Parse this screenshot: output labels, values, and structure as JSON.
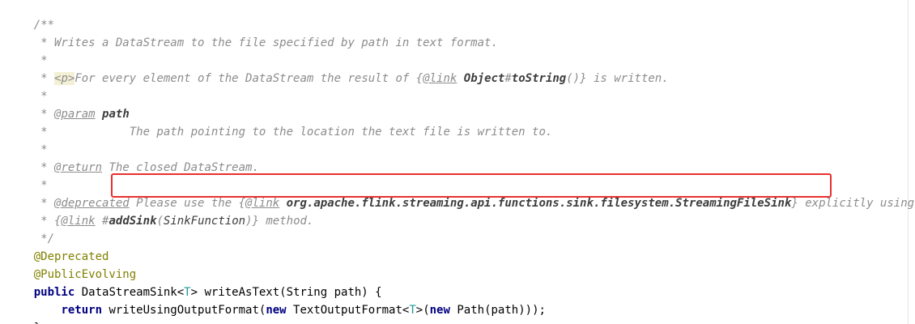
{
  "code": {
    "l1": "/**",
    "l2": " * Writes a DataStream to the file specified by path in text format.",
    "l3": " *",
    "l4_pre": " * ",
    "l4_p": "<p>",
    "l4_mid": "For every element of the DataStream the result of {",
    "l4_link": "@link",
    "l4_sp": " ",
    "l4_obj": "Object",
    "l4_hash": "#",
    "l4_method": "toString",
    "l4_end": "()} is written.",
    "l5": " *",
    "l6_pre": " * ",
    "l6_tag": "@param",
    "l6_sp": " ",
    "l6_name": "path",
    "l7": " *            The path pointing to the location the text file is written to.",
    "l8": " *",
    "l9_pre": " * ",
    "l9_tag": "@return",
    "l9_rest": " The closed DataStream.",
    "l10": " *",
    "l11_pre": " * ",
    "l11_tag": "@deprecated",
    "l11_mid": " Please use the {",
    "l11_link": "@link",
    "l11_sp": " ",
    "l11_ref": "org.apache.flink.streaming.api.functions.sink.filesystem.StreamingFileSink",
    "l11_end": "} explicitly using the",
    "l12_pre": " * {",
    "l12_link": "@link",
    "l12_sp": " ",
    "l12_hash": "#",
    "l12_method": "addSink",
    "l12_paren": "(",
    "l12_arg": "SinkFunction",
    "l12_end": ")} method.",
    "l13": " */",
    "l14": "@Deprecated",
    "l15": "@PublicEvolving",
    "l16_kw": "public",
    "l16_a": " DataStreamSink<",
    "l16_t": "T",
    "l16_b": "> writeAsText(String path) {",
    "l17_indent": "    ",
    "l17_kw": "return",
    "l17_a": " writeUsingOutputFormat(",
    "l17_new1": "new",
    "l17_b": " TextOutputFormat<",
    "l17_t": "T",
    "l17_c": ">(",
    "l17_new2": "new",
    "l17_d": " Path(path)));",
    "l18": "}"
  }
}
